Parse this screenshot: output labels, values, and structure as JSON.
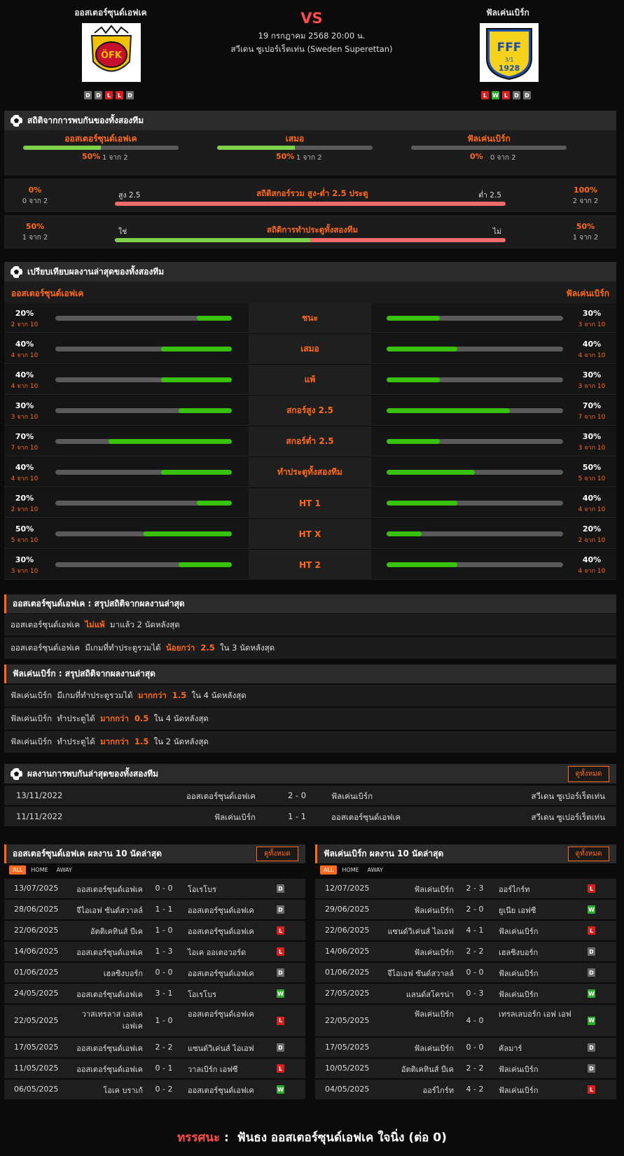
{
  "header": {
    "home_team": "ออสเตอร์ซุนด์เอฟเค",
    "away_team": "ฟัลเค่นเบิร์ก",
    "vs": "VS",
    "datetime": "19 กรกฎาคม 2568 20:00 น.",
    "league": "สวีเดน ซูเปอร์เร็ตเท่น (Sweden Superettan)",
    "home_form": [
      "D",
      "D",
      "L",
      "L",
      "D"
    ],
    "away_form": [
      "L",
      "W",
      "L",
      "D",
      "D"
    ],
    "home_logo_text": "ÖFK",
    "away_logo_text": "FFF",
    "away_logo_sub": "3/1",
    "away_logo_year": "1928"
  },
  "h2h_stats": {
    "title": "สถิติจากการพบกันของทั้งสองทีม",
    "items": [
      {
        "label": "ออสเตอร์ซุนด์เอฟเค",
        "pct": "50%",
        "sub": "1 จาก 2",
        "value": 0.5
      },
      {
        "label": "เสมอ",
        "pct": "50%",
        "sub": "1 จาก 2",
        "value": 0.5
      },
      {
        "label": "ฟัลเค่นเบิร์ก",
        "pct": "0%",
        "sub": "0 จาก 2",
        "value": 0
      }
    ],
    "over_under": {
      "title": "สถิติสกอร์รวม สูง-ต่ำ 2.5 ประตู",
      "left_label": "สูง 2.5",
      "right_label": "ต่ำ 2.5",
      "left_pct": "0%",
      "left_sub": "0 จาก 2",
      "right_pct": "100%",
      "right_sub": "2 จาก 2",
      "value": 0
    },
    "btts": {
      "title": "สถิติการทำประตูทั้งสองทีม",
      "left_label": "ใช่",
      "right_label": "ไม่",
      "left_pct": "50%",
      "left_sub": "1 จาก 2",
      "right_pct": "50%",
      "right_sub": "1 จาก 2",
      "value": 0.5
    }
  },
  "compare": {
    "title": "เปรียบเทียบผลงานล่าสุดของทั้งสองทีม",
    "home": "ออสเตอร์ซุนด์เอฟเค",
    "away": "ฟัลเค่นเบิร์ก",
    "rows": [
      {
        "label": "ชนะ",
        "hp": "20%",
        "hs": "2 จาก 10",
        "hv": 0.2,
        "ap": "30%",
        "as": "3 จาก 10",
        "av": 0.3
      },
      {
        "label": "เสมอ",
        "hp": "40%",
        "hs": "4 จาก 10",
        "hv": 0.4,
        "ap": "40%",
        "as": "4 จาก 10",
        "av": 0.4
      },
      {
        "label": "แพ้",
        "hp": "40%",
        "hs": "4 จาก 10",
        "hv": 0.4,
        "ap": "30%",
        "as": "3 จาก 10",
        "av": 0.3
      },
      {
        "label": "สกอร์สูง 2.5",
        "hp": "30%",
        "hs": "3 จาก 10",
        "hv": 0.3,
        "ap": "70%",
        "as": "7 จาก 10",
        "av": 0.7
      },
      {
        "label": "สกอร์ต่ำ 2.5",
        "hp": "70%",
        "hs": "7 จาก 10",
        "hv": 0.7,
        "ap": "30%",
        "as": "3 จาก 10",
        "av": 0.3
      },
      {
        "label": "ทำประตูทั้งสองทีม",
        "hp": "40%",
        "hs": "4 จาก 10",
        "hv": 0.4,
        "ap": "50%",
        "as": "5 จาก 10",
        "av": 0.5
      },
      {
        "label": "HT 1",
        "hp": "20%",
        "hs": "2 จาก 10",
        "hv": 0.2,
        "ap": "40%",
        "as": "4 จาก 10",
        "av": 0.4
      },
      {
        "label": "HT X",
        "hp": "50%",
        "hs": "5 จาก 10",
        "hv": 0.5,
        "ap": "20%",
        "as": "2 จาก 10",
        "av": 0.2
      },
      {
        "label": "HT 2",
        "hp": "30%",
        "hs": "3 จาก 10",
        "hv": 0.3,
        "ap": "40%",
        "as": "4 จาก 10",
        "av": 0.4
      }
    ]
  },
  "home_summary": {
    "title": "ออสเตอร์ซุนด์เอฟเค : สรุปสถิติจากผลงานล่าสุด",
    "rows": [
      {
        "pre": "ออสเตอร์ซุนด์เอฟเค  ",
        "hl": "ไม่แพ้",
        "post": "  มาแล้ว 2 นัดหลังสุด"
      },
      {
        "pre": "ออสเตอร์ซุนด์เอฟเค  มีเกมที่ทำประตูรวมได้  ",
        "hl": "น้อยกว่า  2.5",
        "post": "  ใน 3 นัดหลังสุด"
      }
    ]
  },
  "away_summary": {
    "title": "ฟัลเค่นเบิร์ก : สรุปสถิติจากผลงานล่าสุด",
    "rows": [
      {
        "pre": "ฟัลเค่นเบิร์ก  มีเกมที่ทำประตูรวมได้  ",
        "hl": "มากกว่า  1.5",
        "post": "  ใน 4 นัดหลังสุด"
      },
      {
        "pre": "ฟัลเค่นเบิร์ก  ทำประตูได้  ",
        "hl": "มากกว่า  0.5",
        "post": "  ใน 4 นัดหลังสุด"
      },
      {
        "pre": "ฟัลเค่นเบิร์ก  ทำประตูได้  ",
        "hl": "มากกว่า  1.5",
        "post": "  ใน 2 นัดหลังสุด"
      }
    ]
  },
  "h2h_results": {
    "title": "ผลงานการพบกันล่าสุดของทั้งสองทีม",
    "view_all": "ดูทั้งหมด",
    "rows": [
      {
        "date": "13/11/2022",
        "home": "ออสเตอร์ซุนด์เอฟเค",
        "score": "2 - 0",
        "away": "ฟัลเค่นเบิร์ก",
        "league": "สวีเดน ซูเปอร์เร็ตเท่น"
      },
      {
        "date": "11/11/2022",
        "home": "ฟัลเค่นเบิร์ก",
        "score": "1 - 1",
        "away": "ออสเตอร์ซุนด์เอฟเค",
        "league": "สวีเดน ซูเปอร์เร็ตเท่น"
      }
    ]
  },
  "home_last10": {
    "title": "ออสเตอร์ซุนด์เอฟเค ผลงาน 10 นัดล่าสุด",
    "view_all": "ดูทั้งหมด",
    "tabs": [
      "ALL",
      "HOME",
      "AWAY"
    ],
    "rows": [
      {
        "date": "13/07/2025",
        "home": "ออสเตอร์ซุนด์เอฟเค",
        "score": "0 - 0",
        "away": "โอเรโบร",
        "res": "D"
      },
      {
        "date": "28/06/2025",
        "home": "จีไอเอฟ ซันด์สวาลล์",
        "score": "1 - 1",
        "away": "ออสเตอร์ซุนด์เอฟเค",
        "res": "D"
      },
      {
        "date": "22/06/2025",
        "home": "อัตติเคทินส์ บีเค",
        "score": "1 - 0",
        "away": "ออสเตอร์ซุนด์เอฟเค",
        "res": "L"
      },
      {
        "date": "14/06/2025",
        "home": "ออสเตอร์ซุนด์เอฟเค",
        "score": "1 - 3",
        "away": "ไอเค ออเตอวอร์ด",
        "res": "L"
      },
      {
        "date": "01/06/2025",
        "home": "เฮลซิงบอร์ก",
        "score": "0 - 0",
        "away": "ออสเตอร์ซุนด์เอฟเค",
        "res": "D"
      },
      {
        "date": "24/05/2025",
        "home": "ออสเตอร์ซุนด์เอฟเค",
        "score": "3 - 1",
        "away": "โอเรโบร",
        "res": "W"
      },
      {
        "date": "22/05/2025",
        "home": "วาสเทรลาส เอสเค เอฟเค",
        "score": "1 - 0",
        "away": "ออสเตอร์ซุนด์เอฟเค",
        "res": "L"
      },
      {
        "date": "17/05/2025",
        "home": "ออสเตอร์ซุนด์เอฟเค",
        "score": "2 - 2",
        "away": "แซนด์วิเค่นส์ ไอเอฟ",
        "res": "D"
      },
      {
        "date": "11/05/2025",
        "home": "ออสเตอร์ซุนด์เอฟเค",
        "score": "0 - 1",
        "away": "วาลเบิร์ก เอฟซี",
        "res": "L"
      },
      {
        "date": "06/05/2025",
        "home": "โอเค บราเก้",
        "score": "0 - 2",
        "away": "ออสเตอร์ซุนด์เอฟเค",
        "res": "W"
      }
    ]
  },
  "away_last10": {
    "title": "ฟัลเค่นเบิร์ก ผลงาน 10 นัดล่าสุด",
    "view_all": "ดูทั้งหมด",
    "tabs": [
      "ALL",
      "HOME",
      "AWAY"
    ],
    "rows": [
      {
        "date": "12/07/2025",
        "home": "ฟัลเค่นเบิร์ก",
        "score": "2 - 3",
        "away": "ออร์ไกร์ท",
        "res": "L"
      },
      {
        "date": "29/06/2025",
        "home": "ฟัลเค่นเบิร์ก",
        "score": "2 - 0",
        "away": "ยูเนีย เอฟซี",
        "res": "W"
      },
      {
        "date": "22/06/2025",
        "home": "แซนด์วิเค่นส์ ไอเอฟ",
        "score": "4 - 1",
        "away": "ฟัลเค่นเบิร์ก",
        "res": "L"
      },
      {
        "date": "14/06/2025",
        "home": "ฟัลเค่นเบิร์ก",
        "score": "2 - 2",
        "away": "เฮลซิงบอร์ก",
        "res": "D"
      },
      {
        "date": "01/06/2025",
        "home": "จีไอเอฟ ซันด์สวาลล์",
        "score": "0 - 0",
        "away": "ฟัลเค่นเบิร์ก",
        "res": "D"
      },
      {
        "date": "27/05/2025",
        "home": "แลนด์สโครน่า",
        "score": "0 - 3",
        "away": "ฟัลเค่นเบิร์ก",
        "res": "W"
      },
      {
        "date": "22/05/2025",
        "home": "ฟัลเค่นเบิร์ก",
        "score": "4 - 0",
        "away": "เทรลเลบอร์ก เอฟ เอฟ",
        "res": "W"
      },
      {
        "date": "17/05/2025",
        "home": "ฟัลเค่นเบิร์ก",
        "score": "0 - 0",
        "away": "คัลมาร์",
        "res": "D"
      },
      {
        "date": "10/05/2025",
        "home": "อัตติเคทินส์ บีเค",
        "score": "2 - 2",
        "away": "ฟัลเค่นเบิร์ก",
        "res": "D"
      },
      {
        "date": "04/05/2025",
        "home": "ออร์ไกร์ท",
        "score": "4 - 2",
        "away": "ฟัลเค่นเบิร์ก",
        "res": "L"
      }
    ]
  },
  "verdict": {
    "label": "ทรรศนะ",
    "sep": " :  ",
    "text": "ฟันธง ออสเตอร์ซุนด์เอฟเค ใจนิ่ง (ต่อ 0)"
  },
  "colors": {
    "accent": "#ff6a1f",
    "win": "#2eaa2e",
    "loss": "#d42020",
    "draw": "#6a6a6a",
    "bar_green": "#39c20c",
    "bar_red": "#ef6a6a"
  }
}
